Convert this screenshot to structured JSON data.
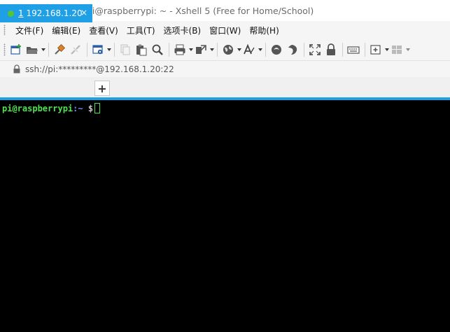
{
  "window": {
    "title": "192.168.1.20 - pi@raspberrypi: ~ - Xshell 5 (Free for Home/School)"
  },
  "menubar": {
    "items": [
      {
        "label": "文件(F)"
      },
      {
        "label": "编辑(E)"
      },
      {
        "label": "查看(V)"
      },
      {
        "label": "工具(T)"
      },
      {
        "label": "选项卡(B)"
      },
      {
        "label": "窗口(W)"
      },
      {
        "label": "帮助(H)"
      }
    ]
  },
  "toolbar": {
    "icons": [
      "new-session-icon",
      "open-folder-icon",
      "connect-icon",
      "disconnect-icon",
      "properties-icon",
      "copy-icon",
      "paste-icon",
      "find-icon",
      "print-icon",
      "transfer-icon",
      "globe-icon",
      "font-icon",
      "xftp-icon",
      "xmanager-icon",
      "fullscreen-icon",
      "lock-icon",
      "keyboard-icon",
      "add-tab-icon",
      "layout-icon"
    ]
  },
  "addressbar": {
    "address": "ssh://pi:*********@192.168.1.20:22"
  },
  "tabs": [
    {
      "index": "1",
      "label": "192.168.1.20",
      "close": "×",
      "status_color": "#55c532"
    }
  ],
  "new_tab_label": "+",
  "terminal": {
    "user_host": "pi@raspberrypi",
    "path": ":~",
    "prompt_symbol": " $ ",
    "colors": {
      "background": "#000000",
      "prompt": "#4ee24e"
    }
  },
  "colors": {
    "accent": "#1e9fe6"
  }
}
